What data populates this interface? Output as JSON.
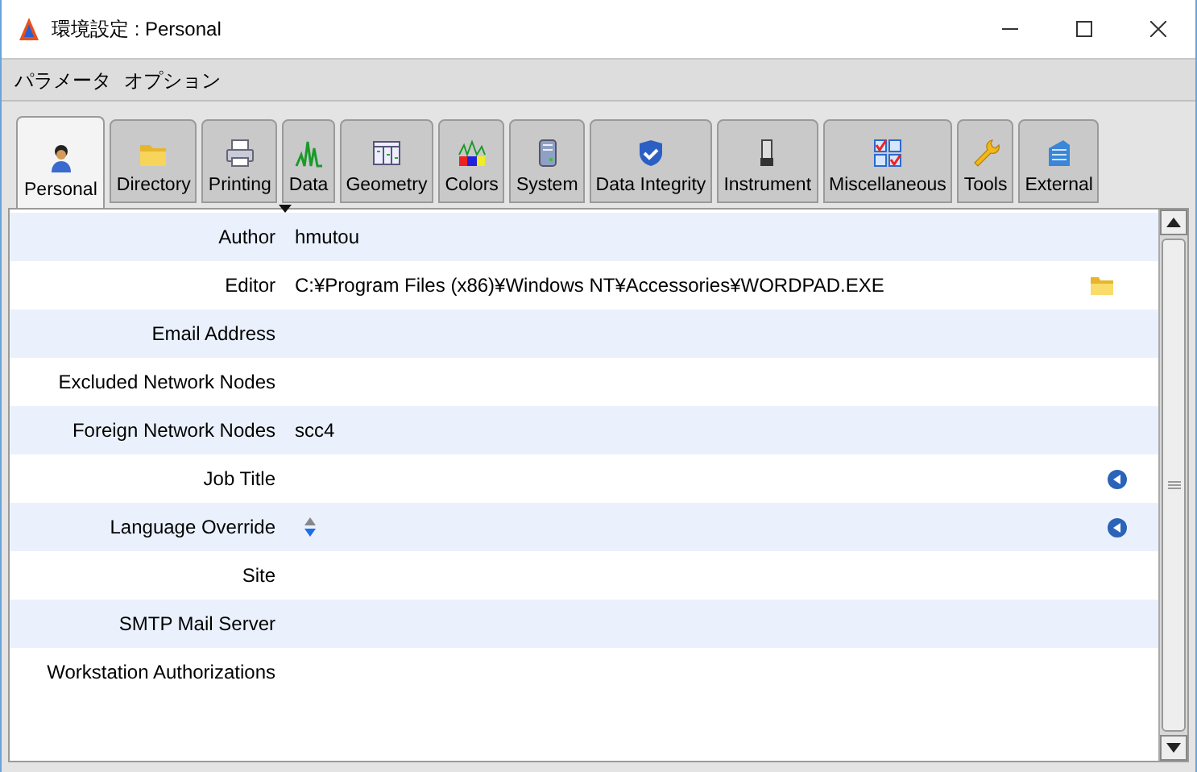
{
  "window": {
    "title": "環境設定 : Personal"
  },
  "menu": [
    "パラメータ",
    "オプション"
  ],
  "tabs": [
    {
      "label": "Personal",
      "selected": true
    },
    {
      "label": "Directory",
      "selected": false
    },
    {
      "label": "Printing",
      "selected": false
    },
    {
      "label": "Data",
      "selected": false
    },
    {
      "label": "Geometry",
      "selected": false
    },
    {
      "label": "Colors",
      "selected": false
    },
    {
      "label": "System",
      "selected": false
    },
    {
      "label": "Data Integrity",
      "selected": false
    },
    {
      "label": "Instrument",
      "selected": false
    },
    {
      "label": "Miscellaneous",
      "selected": false
    },
    {
      "label": "Tools",
      "selected": false
    },
    {
      "label": "External",
      "selected": false
    }
  ],
  "rows": [
    {
      "label": "Author",
      "value": "hmutou",
      "kind": "text"
    },
    {
      "label": "Editor",
      "value": "C:¥Program Files (x86)¥Windows NT¥Accessories¥WORDPAD.EXE",
      "kind": "file"
    },
    {
      "label": "Email Address",
      "kind": "text"
    },
    {
      "label": "Excluded Network Nodes",
      "kind": "text"
    },
    {
      "label": "Foreign Network Nodes",
      "value": "scc4",
      "kind": "text"
    },
    {
      "label": "Job Title",
      "kind": "select"
    },
    {
      "label": "Language Override",
      "kind": "spinner_select"
    },
    {
      "label": "Site",
      "kind": "text"
    },
    {
      "label": "SMTP Mail Server",
      "kind": "text"
    },
    {
      "label": "Workstation Authorizations",
      "kind": "text"
    }
  ]
}
